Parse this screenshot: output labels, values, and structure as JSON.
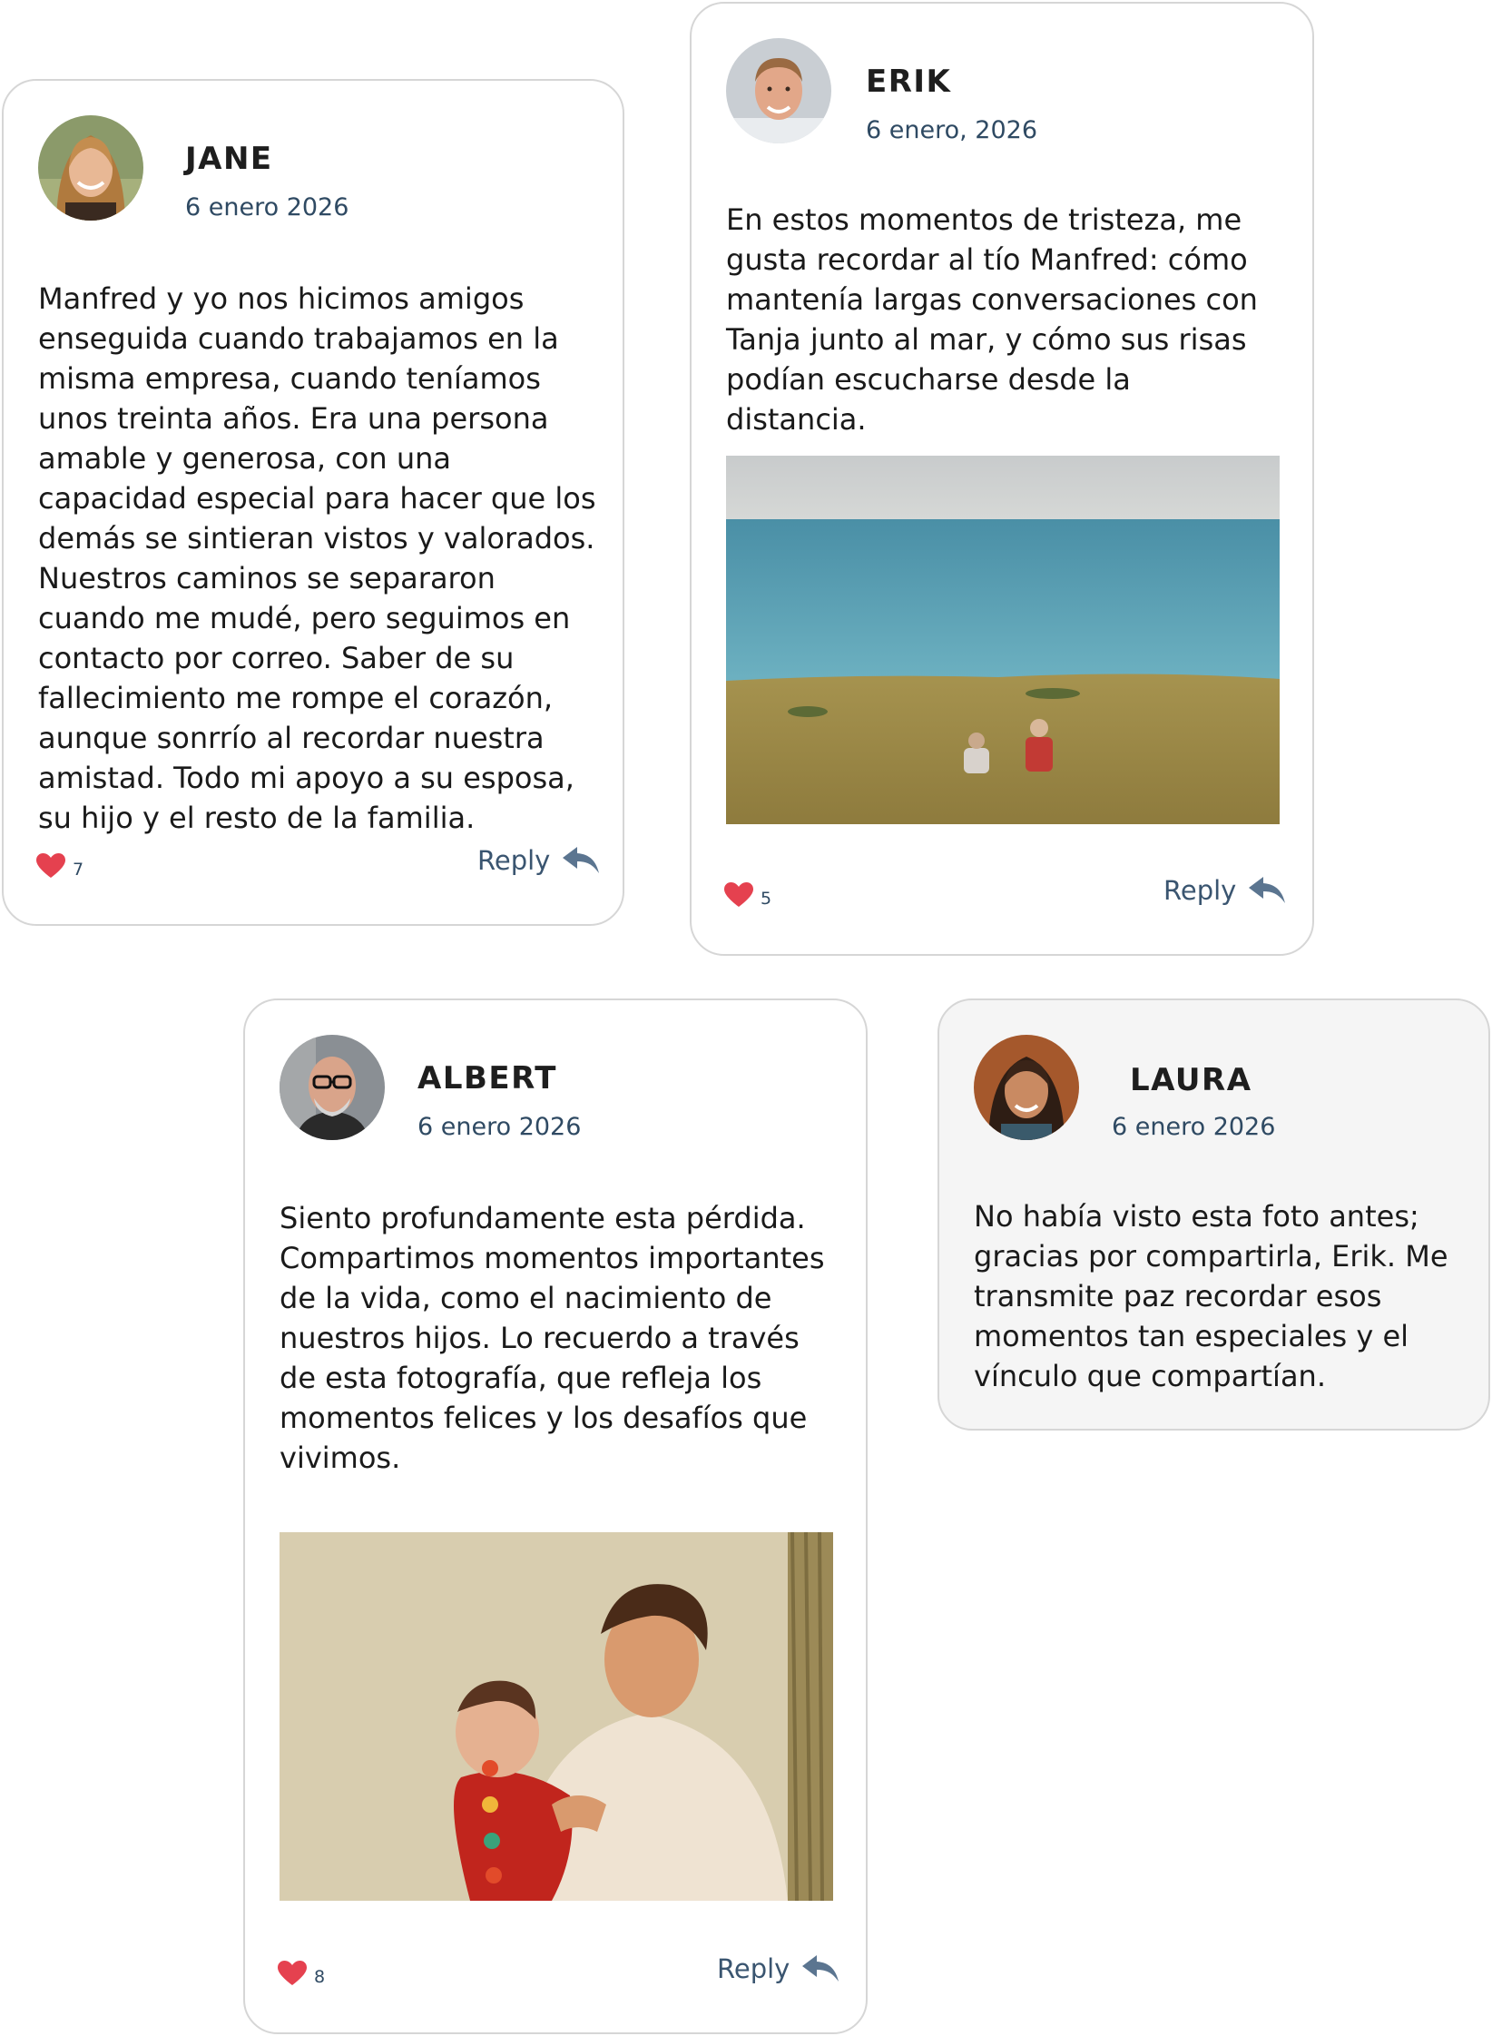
{
  "colors": {
    "heart": "#e5414f",
    "accent_text": "#2f4a63",
    "reply_icon": "#5b7590",
    "card_border": "#d6d6d6"
  },
  "comments": [
    {
      "author": "JANE",
      "date": "6 enero 2026",
      "text": "Manfred y yo nos hicimos amigos enseguida cuando trabajamos en la misma empresa, cuando teníamos unos treinta años. Era una persona amable y generosa, con una capacidad especial para hacer que los demás se sintieran vistos y valorados. Nuestros caminos se separaron cuando me mudé, pero seguimos en contacto por correo. Saber de su fallecimiento me rompe el corazón, aunque sonrrío al recordar nuestra amistad. Todo mi apoyo a su esposa, su hijo y el resto de la familia.",
      "likes": "7",
      "reply_label": "Reply",
      "avatar_icon": "avatar-jane"
    },
    {
      "author": "ERIK",
      "date": "6 enero, 2026",
      "text": "En estos momentos de tristeza, me gusta recordar al tío Manfred: cómo mantenía largas conversaciones con Tanja junto al mar, y cómo sus risas podían escucharse desde la distancia.",
      "likes": "5",
      "reply_label": "Reply",
      "photo_icon": "seaside-photo"
    },
    {
      "author": "ALBERT",
      "date": "6 enero 2026",
      "text": "Siento profundamente esta pérdida. Compartimos momentos importantes de la vida, como el nacimiento de nuestros hijos. Lo recuerdo a través de esta fotografía, que refleja los momentos felices y los desafíos que vivimos.",
      "likes": "8",
      "reply_label": "Reply",
      "photo_icon": "father-baby-photo"
    },
    {
      "author": "LAURA",
      "date": "6 enero 2026",
      "text": "No había visto esta foto antes; gracias por compartirla, Erik. Me transmite paz recordar esos momentos tan especiales y el vínculo que compartían."
    }
  ]
}
